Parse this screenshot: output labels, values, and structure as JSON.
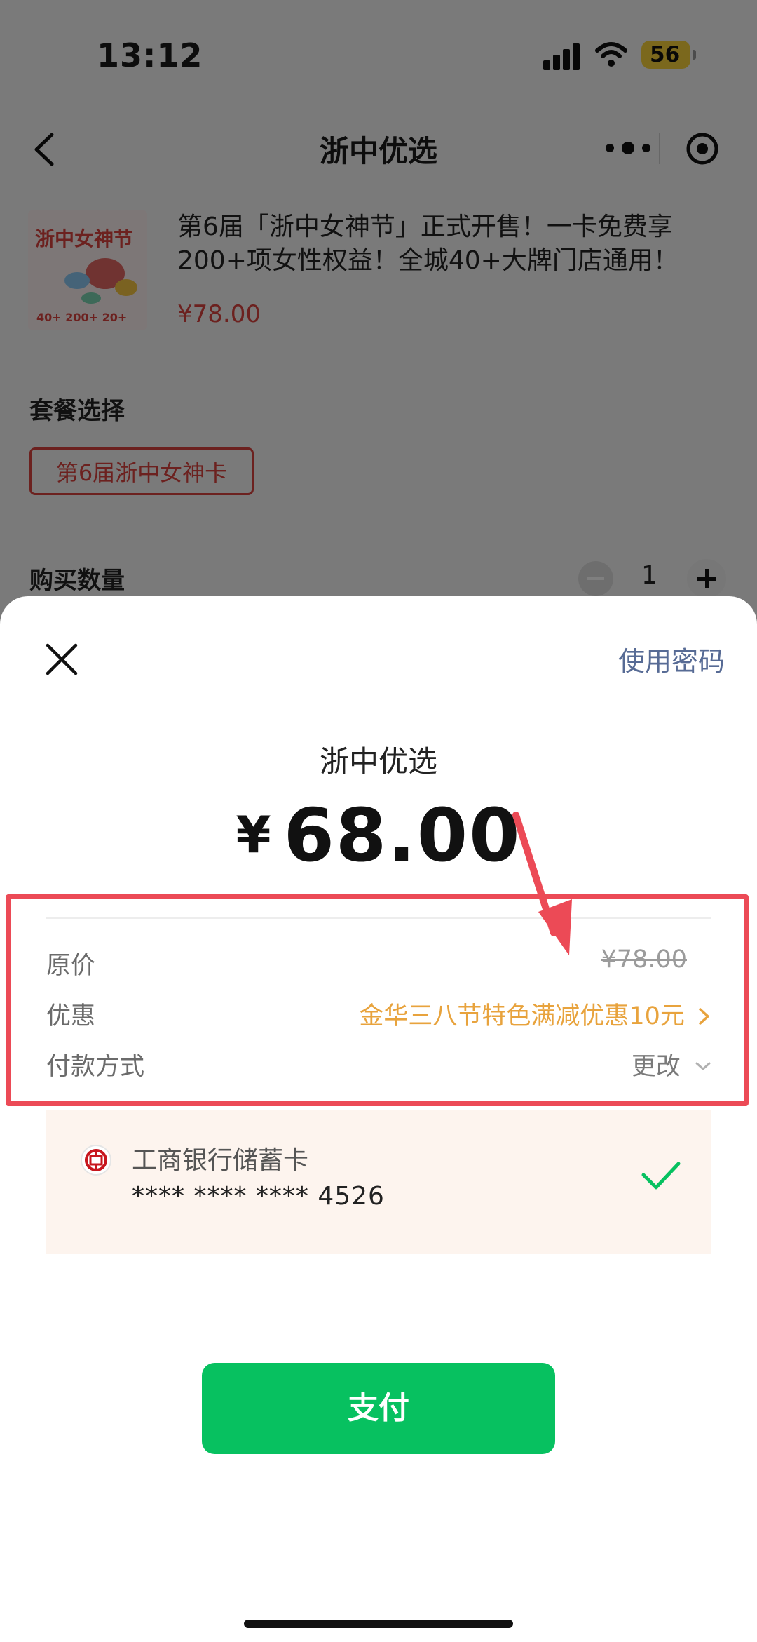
{
  "status_bar": {
    "time": "13:12",
    "battery": "56"
  },
  "navbar": {
    "title": "浙中优选"
  },
  "product": {
    "image_text": "浙中女神节",
    "title": "第6届「浙中女神节」正式开售！一卡免费享200+项女性权益！全城40+大牌门店通用！",
    "price": "¥78.00"
  },
  "package": {
    "section_label": "套餐选择",
    "selected": "第6届浙中女神卡"
  },
  "quantity": {
    "label": "购买数量",
    "value": "1"
  },
  "payment_sheet": {
    "use_password": "使用密码",
    "merchant": "浙中优选",
    "currency": "¥",
    "amount": "68.00",
    "original_price_label": "原价",
    "original_price": "¥78.00",
    "discount_label": "优惠",
    "discount_value": "金华三八节特色满减优惠10元",
    "payment_method_label": "付款方式",
    "change_label": "更改",
    "card": {
      "bank": "工商银行储蓄卡",
      "number": "**** **** **** 4526"
    },
    "pay_button": "支付"
  },
  "colors": {
    "accent_green": "#07c160",
    "price_red": "#d9433f",
    "discount_orange": "#e8a33d",
    "highlight_red": "#ec4a56",
    "link_blue": "#576b95"
  }
}
